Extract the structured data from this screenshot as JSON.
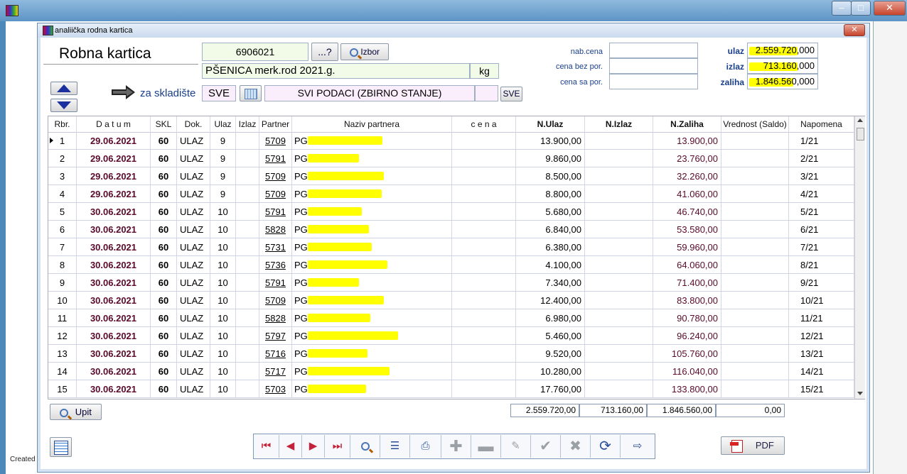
{
  "outer_window": {
    "created_text": "Created"
  },
  "child_window": {
    "title": "analiička rodna kartica",
    "close_label": "✕"
  },
  "header": {
    "title": "Robna kartica",
    "article_code": "6906021",
    "browse_label": "...?",
    "izbor_label": "Izbor",
    "article_name": "PŠENICA merk.rod 2021.g.",
    "unit": "kg",
    "za_skladiste_label": "za skladište",
    "warehouse_code": "SVE",
    "warehouse_name": "SVI PODACI (ZBIRNO STANJE)",
    "sve_button_label": "SVE",
    "price_labels": {
      "nab": "nab.cena",
      "bez": "cena bez por.",
      "sa": "cena sa por."
    },
    "summary_labels": {
      "ulaz": "ulaz",
      "izlaz": "izlaz",
      "zaliha": "zaliha"
    },
    "summary_values": {
      "ulaz": "2.559.720,000",
      "izlaz": "713.160,000",
      "zaliha": "1.846.560,000"
    }
  },
  "grid": {
    "columns": [
      "Rbr.",
      "D a t u m",
      "SKL",
      "Dok.",
      "Ulaz",
      "Izlaz",
      "Partner",
      "Naziv partnera",
      "c e n a",
      "N.Ulaz",
      "N.Izlaz",
      "N.Zaliha",
      "Vrednost (Saldo)",
      "Napomena"
    ],
    "rows": [
      {
        "rbr": "1",
        "datum": "29.06.2021",
        "skl": "60",
        "dok": "ULAZ",
        "ulaz": "9",
        "izlaz": "",
        "partner": "5709",
        "naziv": "PG",
        "cena": "",
        "n_ulaz": "13.900,00",
        "n_izlaz": "",
        "n_zaliha": "13.900,00",
        "vrednost": "",
        "napomena": "1/21"
      },
      {
        "rbr": "2",
        "datum": "29.06.2021",
        "skl": "60",
        "dok": "ULAZ",
        "ulaz": "9",
        "izlaz": "",
        "partner": "5791",
        "naziv": "PG",
        "cena": "",
        "n_ulaz": "9.860,00",
        "n_izlaz": "",
        "n_zaliha": "23.760,00",
        "vrednost": "",
        "napomena": "2/21"
      },
      {
        "rbr": "3",
        "datum": "29.06.2021",
        "skl": "60",
        "dok": "ULAZ",
        "ulaz": "9",
        "izlaz": "",
        "partner": "5709",
        "naziv": "PG",
        "cena": "",
        "n_ulaz": "8.500,00",
        "n_izlaz": "",
        "n_zaliha": "32.260,00",
        "vrednost": "",
        "napomena": "3/21"
      },
      {
        "rbr": "4",
        "datum": "29.06.2021",
        "skl": "60",
        "dok": "ULAZ",
        "ulaz": "9",
        "izlaz": "",
        "partner": "5709",
        "naziv": "PG",
        "cena": "",
        "n_ulaz": "8.800,00",
        "n_izlaz": "",
        "n_zaliha": "41.060,00",
        "vrednost": "",
        "napomena": "4/21"
      },
      {
        "rbr": "5",
        "datum": "30.06.2021",
        "skl": "60",
        "dok": "ULAZ",
        "ulaz": "10",
        "izlaz": "",
        "partner": "5791",
        "naziv": "PG",
        "cena": "",
        "n_ulaz": "5.680,00",
        "n_izlaz": "",
        "n_zaliha": "46.740,00",
        "vrednost": "",
        "napomena": "5/21"
      },
      {
        "rbr": "6",
        "datum": "30.06.2021",
        "skl": "60",
        "dok": "ULAZ",
        "ulaz": "10",
        "izlaz": "",
        "partner": "5828",
        "naziv": "PG",
        "cena": "",
        "n_ulaz": "6.840,00",
        "n_izlaz": "",
        "n_zaliha": "53.580,00",
        "vrednost": "",
        "napomena": "6/21"
      },
      {
        "rbr": "7",
        "datum": "30.06.2021",
        "skl": "60",
        "dok": "ULAZ",
        "ulaz": "10",
        "izlaz": "",
        "partner": "5731",
        "naziv": "PG",
        "cena": "",
        "n_ulaz": "6.380,00",
        "n_izlaz": "",
        "n_zaliha": "59.960,00",
        "vrednost": "",
        "napomena": "7/21"
      },
      {
        "rbr": "8",
        "datum": "30.06.2021",
        "skl": "60",
        "dok": "ULAZ",
        "ulaz": "10",
        "izlaz": "",
        "partner": "5736",
        "naziv": "PG",
        "cena": "",
        "n_ulaz": "4.100,00",
        "n_izlaz": "",
        "n_zaliha": "64.060,00",
        "vrednost": "",
        "napomena": "8/21"
      },
      {
        "rbr": "9",
        "datum": "30.06.2021",
        "skl": "60",
        "dok": "ULAZ",
        "ulaz": "10",
        "izlaz": "",
        "partner": "5791",
        "naziv": "PG",
        "cena": "",
        "n_ulaz": "7.340,00",
        "n_izlaz": "",
        "n_zaliha": "71.400,00",
        "vrednost": "",
        "napomena": "9/21"
      },
      {
        "rbr": "10",
        "datum": "30.06.2021",
        "skl": "60",
        "dok": "ULAZ",
        "ulaz": "10",
        "izlaz": "",
        "partner": "5709",
        "naziv": "PG",
        "cena": "",
        "n_ulaz": "12.400,00",
        "n_izlaz": "",
        "n_zaliha": "83.800,00",
        "vrednost": "",
        "napomena": "10/21"
      },
      {
        "rbr": "11",
        "datum": "30.06.2021",
        "skl": "60",
        "dok": "ULAZ",
        "ulaz": "10",
        "izlaz": "",
        "partner": "5828",
        "naziv": "PG",
        "cena": "",
        "n_ulaz": "6.980,00",
        "n_izlaz": "",
        "n_zaliha": "90.780,00",
        "vrednost": "",
        "napomena": "11/21"
      },
      {
        "rbr": "12",
        "datum": "30.06.2021",
        "skl": "60",
        "dok": "ULAZ",
        "ulaz": "10",
        "izlaz": "",
        "partner": "5797",
        "naziv": "PG",
        "cena": "",
        "n_ulaz": "5.460,00",
        "n_izlaz": "",
        "n_zaliha": "96.240,00",
        "vrednost": "",
        "napomena": "12/21"
      },
      {
        "rbr": "13",
        "datum": "30.06.2021",
        "skl": "60",
        "dok": "ULAZ",
        "ulaz": "10",
        "izlaz": "",
        "partner": "5716",
        "naziv": "PG",
        "cena": "",
        "n_ulaz": "9.520,00",
        "n_izlaz": "",
        "n_zaliha": "105.760,00",
        "vrednost": "",
        "napomena": "13/21"
      },
      {
        "rbr": "14",
        "datum": "30.06.2021",
        "skl": "60",
        "dok": "ULAZ",
        "ulaz": "10",
        "izlaz": "",
        "partner": "5717",
        "naziv": "PG",
        "cena": "",
        "n_ulaz": "10.280,00",
        "n_izlaz": "",
        "n_zaliha": "116.040,00",
        "vrednost": "",
        "napomena": "14/21"
      },
      {
        "rbr": "15",
        "datum": "30.06.2021",
        "skl": "60",
        "dok": "ULAZ",
        "ulaz": "10",
        "izlaz": "",
        "partner": "5703",
        "naziv": "PG",
        "cena": "",
        "n_ulaz": "17.760,00",
        "n_izlaz": "",
        "n_zaliha": "133.800,00",
        "vrednost": "",
        "napomena": "15/21"
      }
    ]
  },
  "totals": {
    "n_ulaz": "2.559.720,00",
    "n_izlaz": "713.160,00",
    "n_zaliha": "1.846.560,00",
    "vrednost": "0,00"
  },
  "buttons": {
    "upit": "Upit",
    "pdf": "PDF"
  },
  "colors": {
    "highlight": "#ffff00",
    "date_text": "#5a0a2a",
    "label_blue": "#1a3f8a"
  }
}
